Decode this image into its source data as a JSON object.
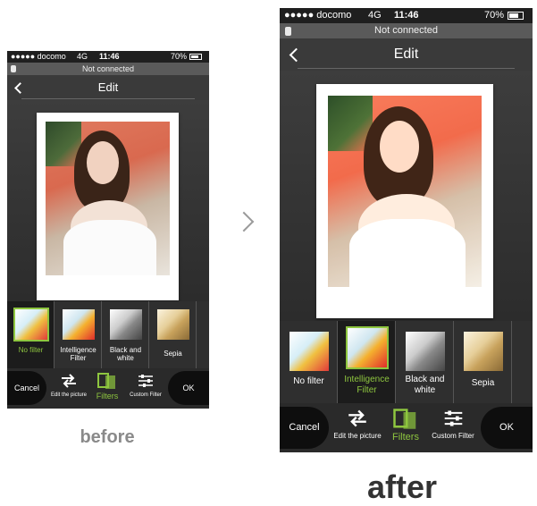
{
  "status": {
    "carrier": "●●●●● docomo",
    "network": "4G",
    "time": "11:46",
    "battery": "70%"
  },
  "connection": "Not connected",
  "nav": {
    "title": "Edit"
  },
  "filters": [
    {
      "label": "No filter",
      "selected_before": true,
      "selected_after": false
    },
    {
      "label": "Intelligence Filter",
      "selected_before": false,
      "selected_after": true
    },
    {
      "label": "Black and white",
      "selected_before": false,
      "selected_after": false
    },
    {
      "label": "Sepia",
      "selected_before": false,
      "selected_after": false
    }
  ],
  "toolbar": {
    "cancel": "Cancel",
    "edit": "Edit the picture",
    "filters": "Filters",
    "custom": "Custom Filter",
    "ok": "OK"
  },
  "captions": {
    "before": "before",
    "after": "after"
  },
  "colors": {
    "accent": "#8ec63f",
    "status_bar": "#1f1f1f",
    "toolbar": "#2a2a2a"
  },
  "icons": [
    "back-chevron-icon",
    "battery-icon",
    "printer-lock-icon",
    "edit-arrows-icon",
    "filters-icon",
    "custom-filter-sliders-icon",
    "next-arrow-icon"
  ]
}
